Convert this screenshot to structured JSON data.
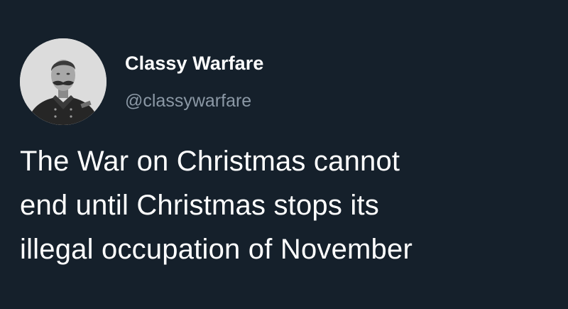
{
  "theme": {
    "background": "#15202b",
    "text": "#ffffff",
    "secondary_text": "#8b98a5"
  },
  "author": {
    "display_name": "Classy Warfare",
    "handle": "@classywarfare",
    "avatar_icon": "portrait-avatar-icon"
  },
  "tweet": {
    "lines": [
      "The War on Christmas cannot",
      "end until Christmas stops its",
      "illegal occupation of November"
    ]
  }
}
